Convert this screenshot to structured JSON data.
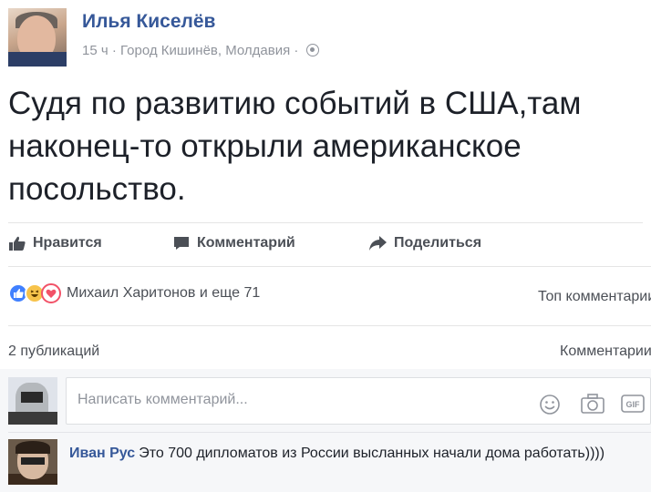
{
  "post": {
    "author": "Илья Киселёв",
    "time": "15 ч",
    "separator": "·",
    "location": "Город Кишинёв, Молдавия",
    "separator2": "·",
    "text": "Судя по развитию событий в США,там наконец-то открыли американское посольство."
  },
  "actions": {
    "like": "Нравится",
    "comment": "Комментарий",
    "share": "Поделиться"
  },
  "reactions": {
    "names": "Михаил Харитонов и еще 71",
    "top_comments": "Топ комментарии",
    "types": [
      "like",
      "haha",
      "love"
    ]
  },
  "stats": {
    "shares": "2 публикаций",
    "comments": "Комментарии"
  },
  "composer": {
    "placeholder": "Написать комментарий..."
  },
  "comment": {
    "author": "Иван Рус",
    "text": "Это 700 дипломатов из России высланных начали дома работать))))"
  },
  "colors": {
    "link": "#365899",
    "like_blue": "#4080ff",
    "haha_yellow": "#f7c34b",
    "love_red": "#f25268"
  }
}
